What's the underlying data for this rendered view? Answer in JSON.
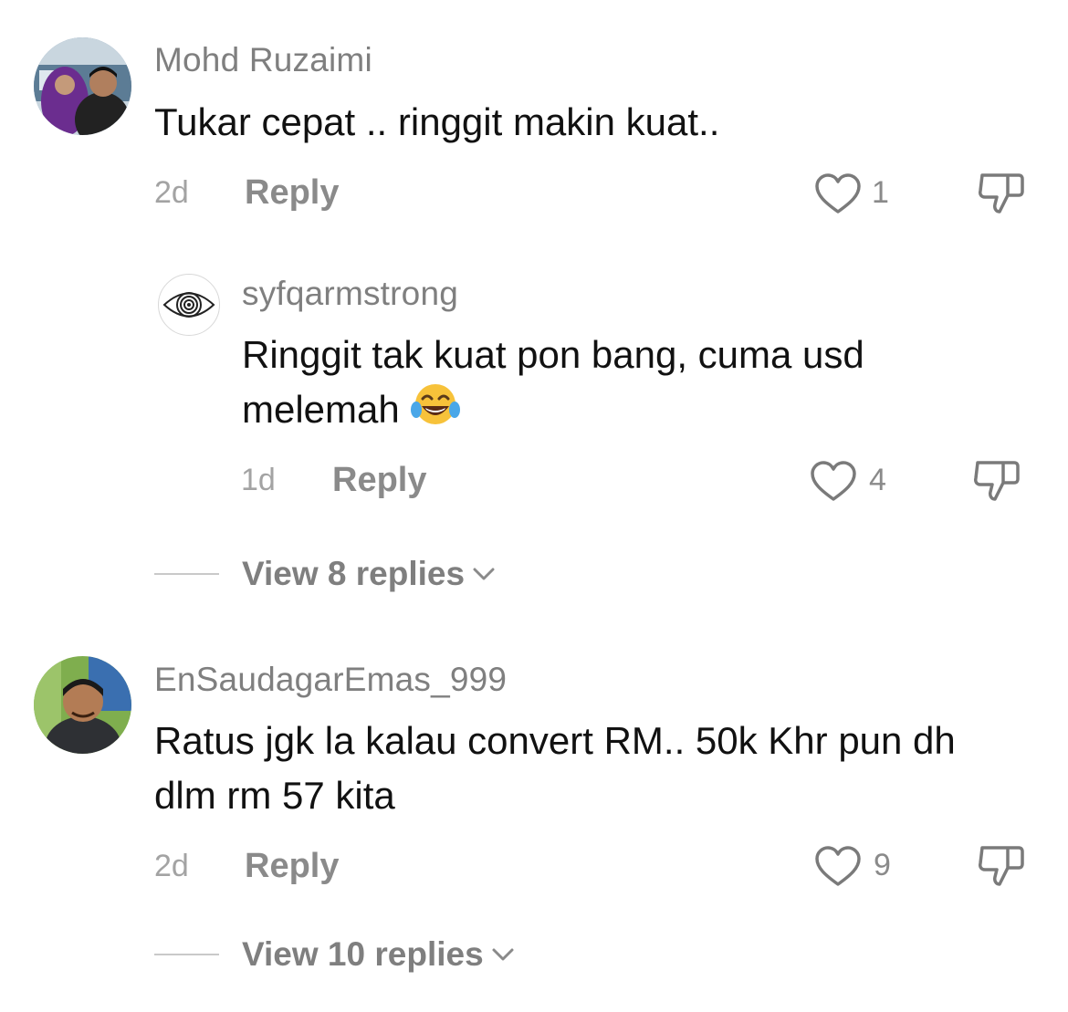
{
  "comments": [
    {
      "username": "Mohd Ruzaimi",
      "text": "Tukar cepat .. ringgit makin kuat..",
      "time": "2d",
      "reply_label": "Reply",
      "likes": "1",
      "avatar_icon": "person-photo-avatar",
      "replies": [
        {
          "username": "syfqarmstrong",
          "text": "Ringgit tak kuat pon bang, cuma usd melemah",
          "emoji": "😂",
          "emoji_icon": "face-with-tears-of-joy-icon",
          "time": "1d",
          "reply_label": "Reply",
          "likes": "4",
          "avatar_icon": "eye-drawing-avatar"
        }
      ],
      "view_replies": "View 8 replies"
    },
    {
      "username": "EnSaudagarEmas_999",
      "text": "Ratus jgk la kalau convert RM.. 50k Khr pun dh dlm rm 57 kita",
      "time": "2d",
      "reply_label": "Reply",
      "likes": "9",
      "avatar_icon": "person-photo-avatar",
      "view_replies": "View 10 replies"
    }
  ],
  "colors": {
    "text": "#111111",
    "username": "#7f7f7f",
    "muted": "#a3a3a3",
    "icon": "#7a7a7a"
  }
}
